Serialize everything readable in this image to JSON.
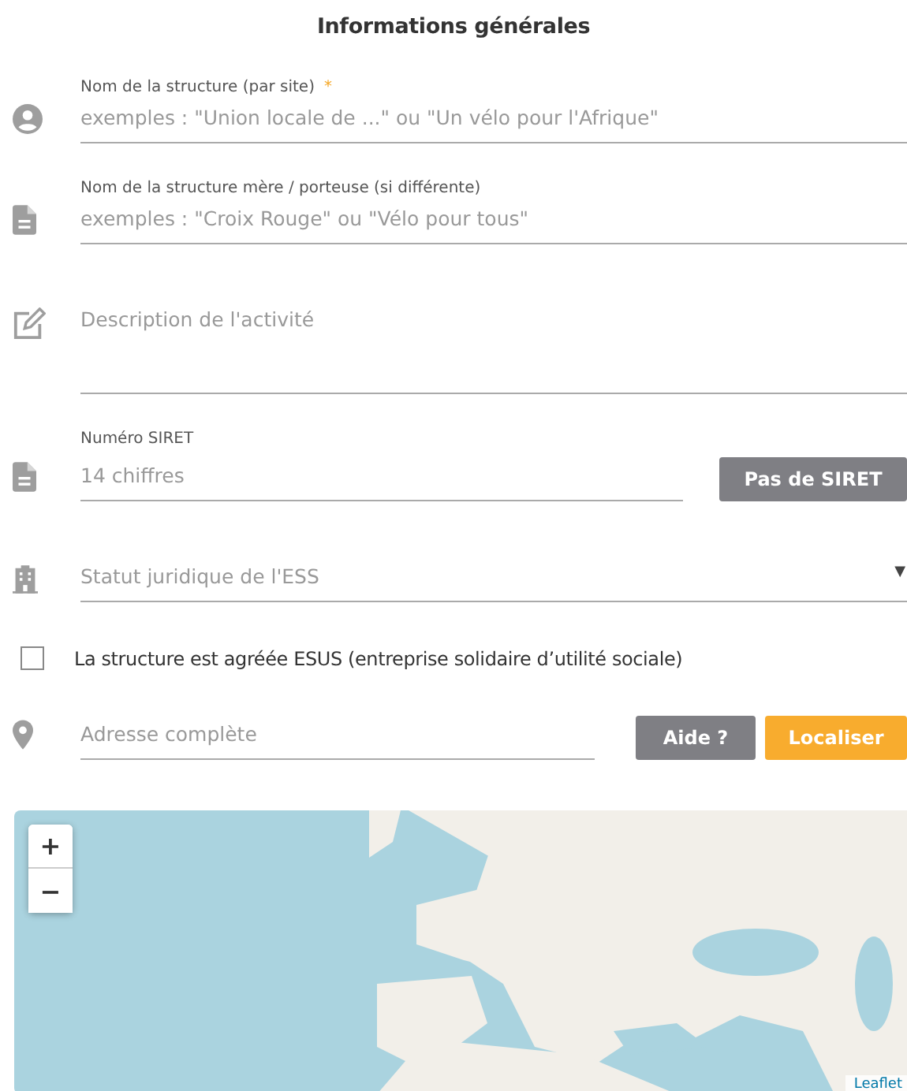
{
  "section_title": "Informations générales",
  "fields": [
    {
      "kind": "text",
      "label": "Nom de la structure (par site)",
      "required_mark": "*",
      "placeholder": "exemples : \"Union locale de ...\" ou \"Un vélo pour l'Afrique\""
    },
    {
      "kind": "text",
      "label": "Nom de la structure mère / porteuse (si différente)",
      "placeholder": "exemples : \"Croix Rouge\" ou \"Vélo pour tous\""
    },
    {
      "kind": "textarea",
      "placeholder": "Description de l'activité"
    },
    {
      "kind": "siret",
      "label": "Numéro SIRET",
      "placeholder": "14 chiffres",
      "button": "Pas de SIRET"
    },
    {
      "kind": "select",
      "placeholder": "Statut juridique de l'ESS",
      "arrow": "▼"
    },
    {
      "kind": "checkbox",
      "label": "La structure est agréée ESUS (entreprise solidaire d’utilité sociale)",
      "checked": false
    },
    {
      "kind": "address",
      "placeholder": "Adresse complète",
      "buttons": [
        "Aide ?",
        "Localiser"
      ]
    }
  ],
  "map": {
    "zoom_in": "+",
    "zoom_out": "−",
    "attribution": "Leaflet"
  }
}
